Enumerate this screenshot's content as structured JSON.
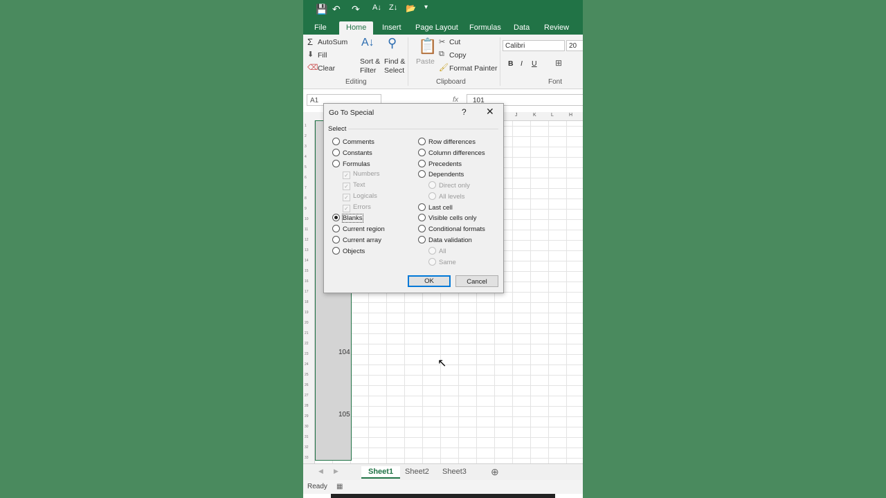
{
  "ribbon": {
    "tabs": [
      "File",
      "Home",
      "Insert",
      "Page Layout",
      "Formulas",
      "Data",
      "Review"
    ],
    "active_tab": "Home",
    "editing": {
      "autosum": "AutoSum",
      "fill": "Fill",
      "clear": "Clear",
      "sort": "Sort &",
      "sort2": "Filter",
      "find": "Find &",
      "find2": "Select",
      "label": "Editing"
    },
    "clipboard": {
      "cut": "Cut",
      "copy": "Copy",
      "paste": "Paste",
      "format_painter": "Format Painter",
      "label": "Clipboard"
    },
    "font": {
      "name": "Calibri",
      "size": "20",
      "label": "Font",
      "bold": "B",
      "italic": "I",
      "underline": "U"
    }
  },
  "formula_bar": {
    "name_box": "A1",
    "fx": "fx",
    "value": "101"
  },
  "columns": [
    "J",
    "K",
    "L",
    "H"
  ],
  "cells": {
    "v104": "104",
    "v105": "105"
  },
  "sheets": [
    "Sheet1",
    "Sheet2",
    "Sheet3"
  ],
  "active_sheet": "Sheet1",
  "status": "Ready",
  "dialog": {
    "title": "Go To Special",
    "help": "?",
    "close": "✕",
    "select_label": "Select",
    "left_options": [
      "Comments",
      "Constants",
      "Formulas",
      "Numbers",
      "Text",
      "Logicals",
      "Errors",
      "Blanks",
      "Current region",
      "Current array",
      "Objects"
    ],
    "right_options": [
      "Row differences",
      "Column differences",
      "Precedents",
      "Dependents",
      "Direct only",
      "All levels",
      "Last cell",
      "Visible cells only",
      "Conditional formats",
      "Data validation",
      "All",
      "Same"
    ],
    "selected": "Blanks",
    "ok": "OK",
    "cancel": "Cancel"
  },
  "colors": {
    "excel_green": "#217346",
    "background": "#4a8a5e",
    "accent_blue": "#0078d7"
  }
}
